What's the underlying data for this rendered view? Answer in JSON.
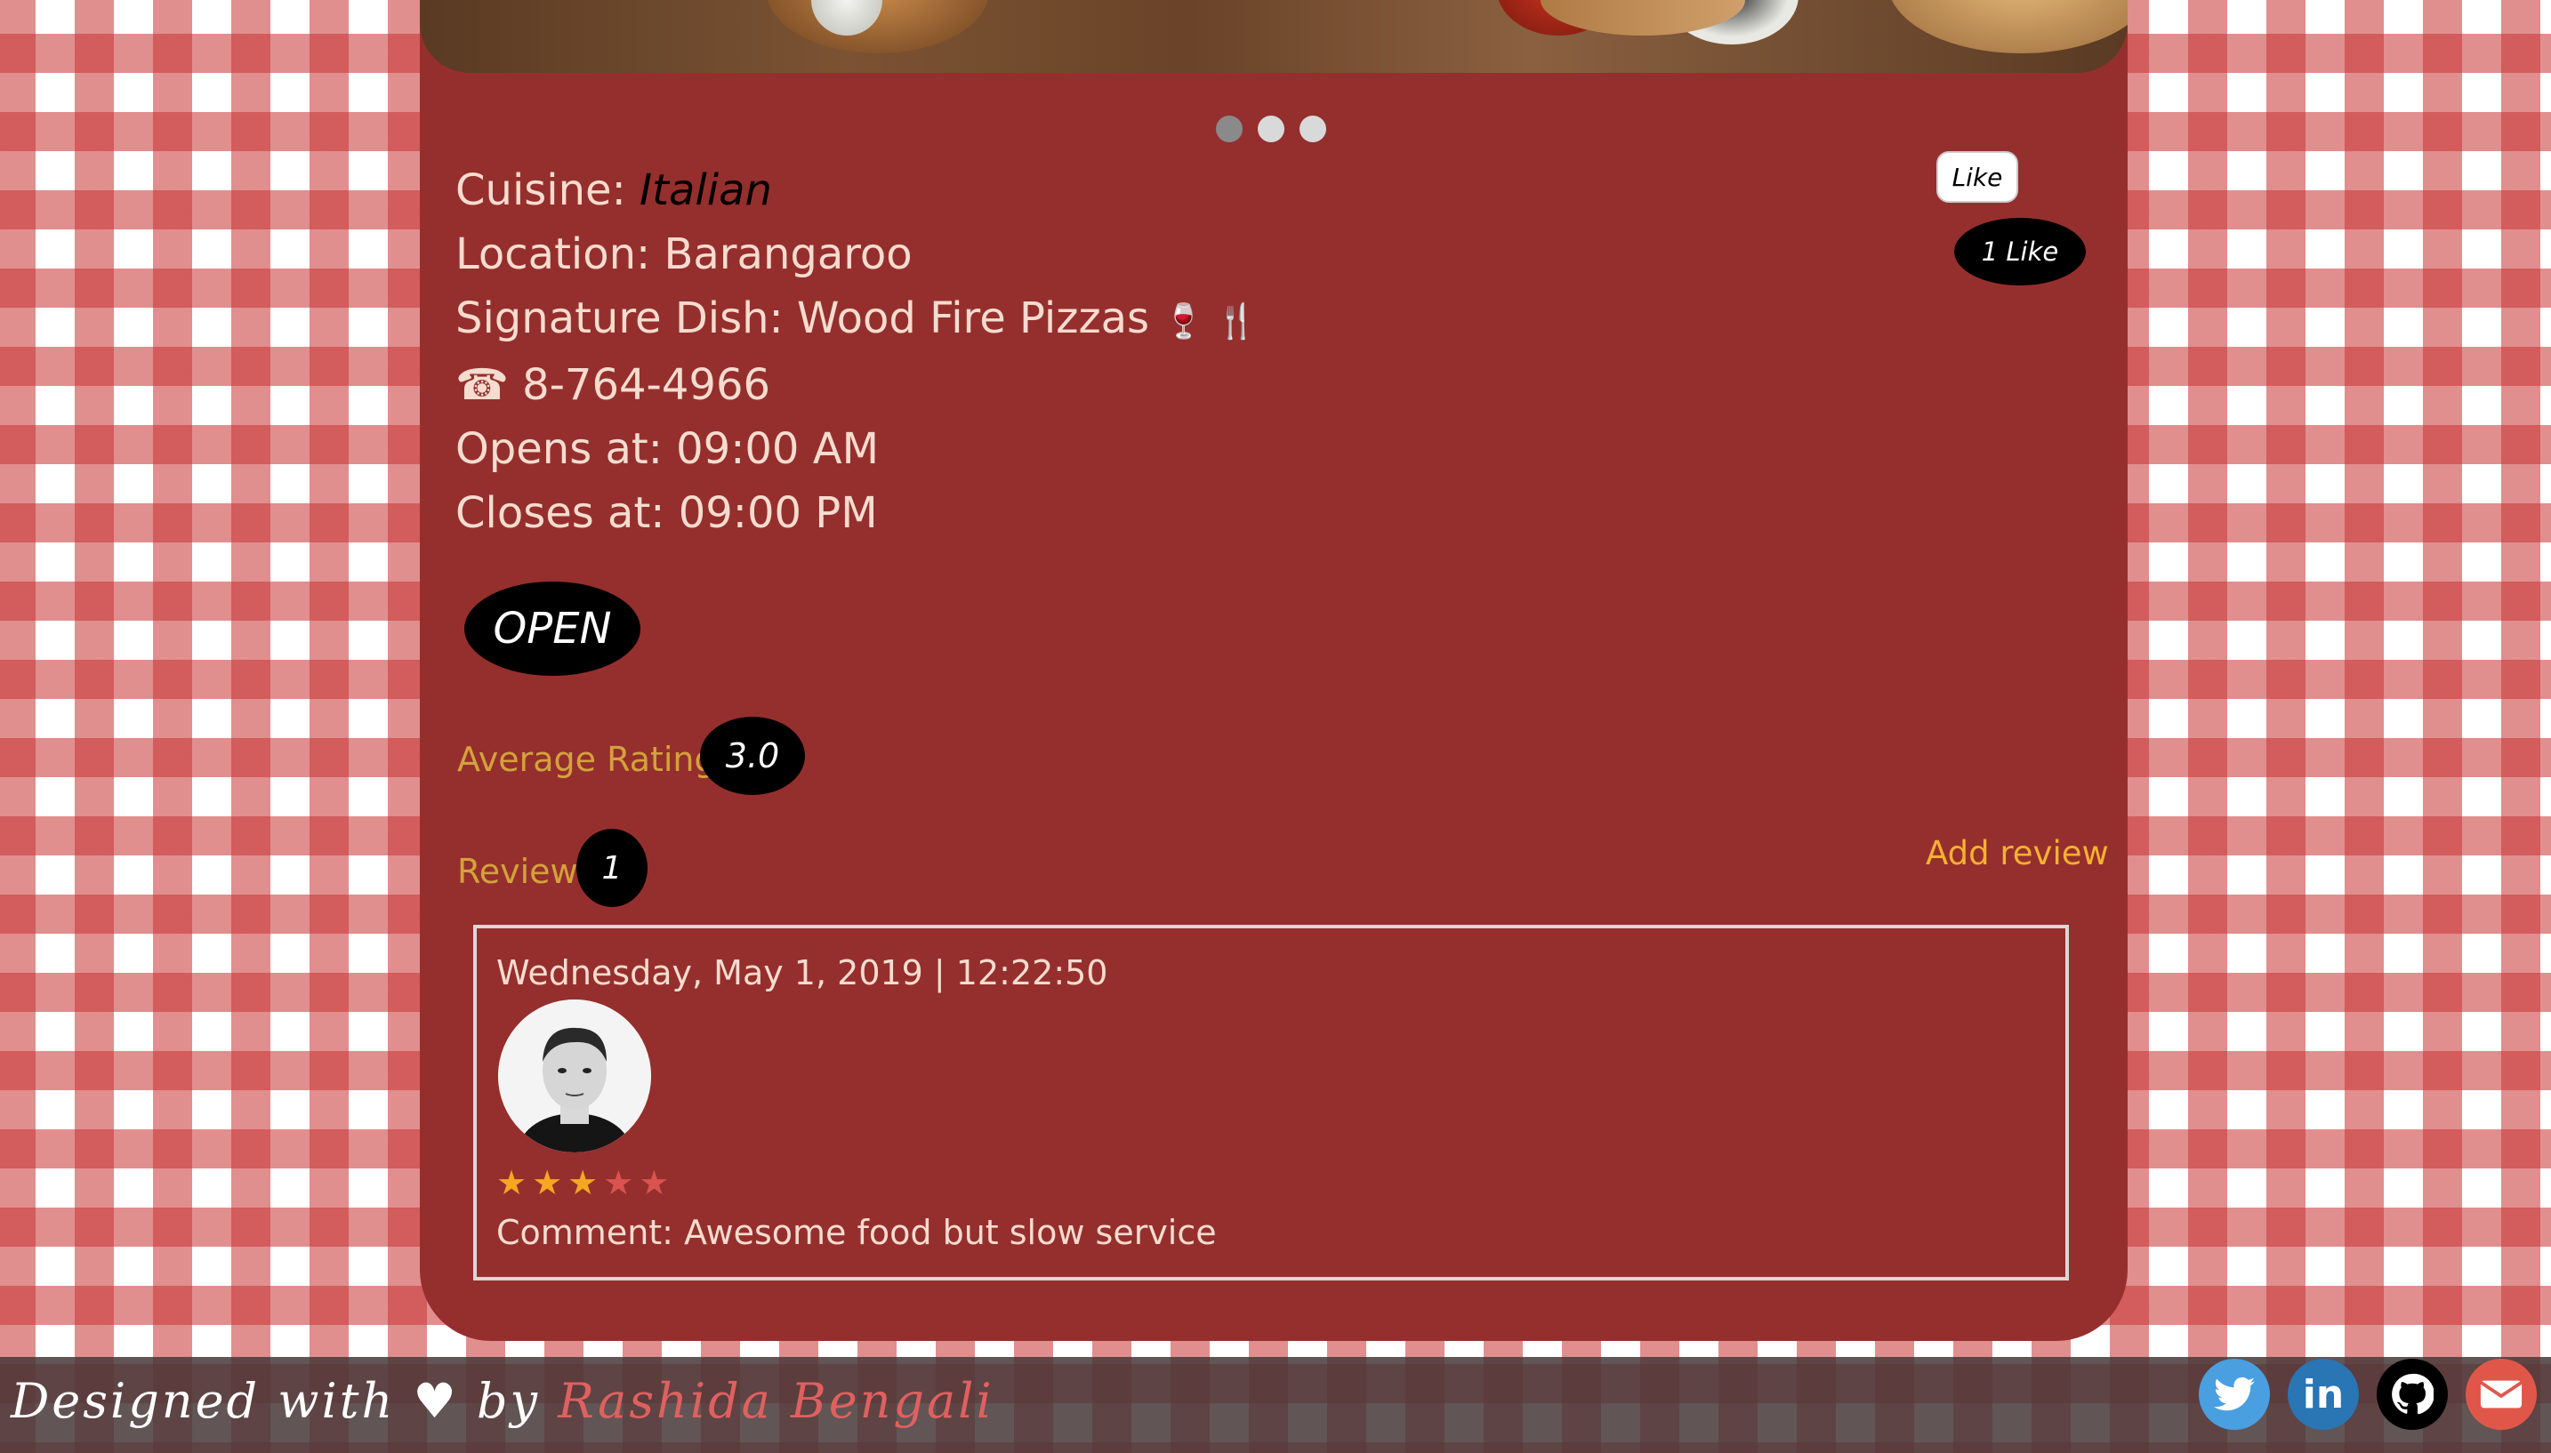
{
  "restaurant": {
    "cuisine_label": "Cuisine:",
    "cuisine_value": "Italian",
    "location_label": "Location:",
    "location_value": "Barangaroo",
    "signature_label": "Signature Dish:",
    "signature_value": "Wood Fire Pizzas",
    "signature_emoji": "🍷 🍴",
    "phone_icon": "☎",
    "phone": "8-764-4966",
    "opens_label": "Opens at:",
    "opens_value": "09:00 AM",
    "closes_label": "Closes at:",
    "closes_value": "09:00 PM",
    "status": "OPEN"
  },
  "carousel": {
    "slides": 3,
    "active_index": 0
  },
  "likes": {
    "button_label": "Like",
    "count_label": "1 Like"
  },
  "rating": {
    "label": "Average Rating:",
    "value": "3.0"
  },
  "reviews": {
    "label": "Review:",
    "count": "1",
    "add_label": "Add review",
    "items": [
      {
        "date": "Wednesday, May 1, 2019 | 12:22:50",
        "stars": 3,
        "max_stars": 5,
        "comment": "Comment: Awesome food but slow service"
      }
    ]
  },
  "footer": {
    "prefix": "Designed with ♥ by",
    "author": "Rashida Bengali",
    "social": [
      "twitter-icon",
      "linkedin-icon",
      "github-icon",
      "email-icon"
    ]
  },
  "colors": {
    "card": "#952f2d",
    "accent": "#d4a23c",
    "link": "#f5b032",
    "twitter": "#4a9fe0",
    "linkedin": "#2a75b3",
    "github": "#000000",
    "email": "#e0574a"
  }
}
